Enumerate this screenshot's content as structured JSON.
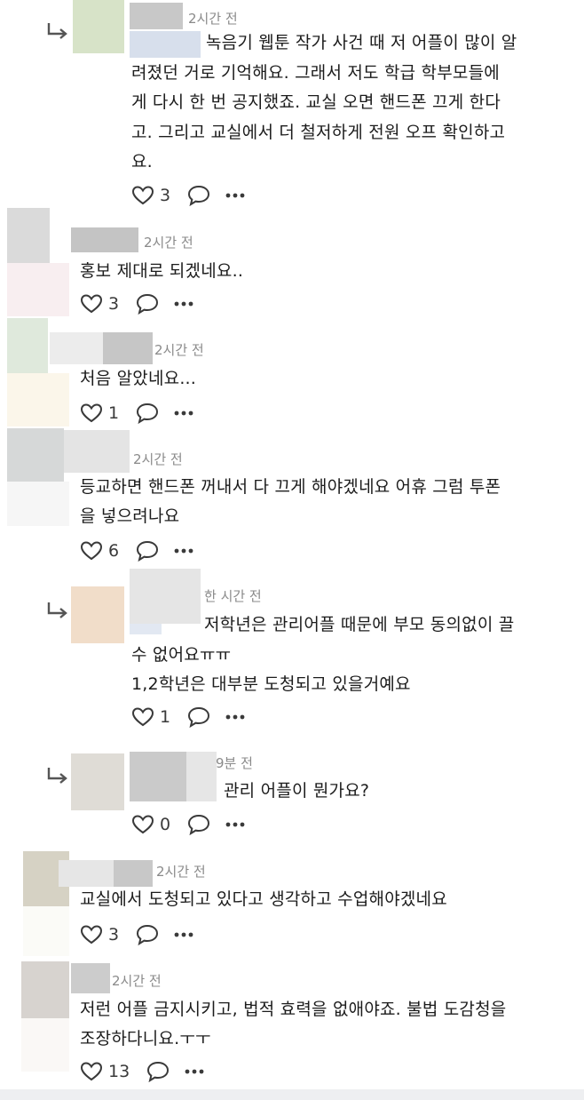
{
  "comments": [
    {
      "time": "2시간 전",
      "lines": [
        "녹음기 웹툰 작가 사건 때 저 어플이 많이 알",
        "려졌던 거로 기억해요. 그래서 저도 학급 학부모들에",
        "게 다시 한 번 공지했죠. 교실 오면 핸드폰 끄게 한다",
        "고. 그리고 교실에서 더 철저하게 전원 오프 확인하고",
        "요."
      ],
      "likes": "3"
    },
    {
      "time": "2시간 전",
      "lines": [
        "홍보 제대로 되겠네요.."
      ],
      "likes": "3"
    },
    {
      "time": "2시간 전",
      "lines": [
        "처음 알았네요..."
      ],
      "likes": "1"
    },
    {
      "time": "2시간 전",
      "lines": [
        "등교하면 핸드폰 꺼내서 다 끄게 해야겠네요 어휴 그럼 투폰",
        "을 넣으려나요"
      ],
      "likes": "6"
    },
    {
      "time": "한 시간 전",
      "lines": [
        "저학년은 관리어플 때문에 부모 동의없이 끌",
        "수 없어요ㅠㅠ",
        "1,2학년은 대부분 도청되고 있을거예요"
      ],
      "likes": "1"
    },
    {
      "time": "9분 전",
      "lines": [
        "관리 어플이 뭔가요?"
      ],
      "likes": "0"
    },
    {
      "time": "2시간 전",
      "lines": [
        "교실에서 도청되고 있다고 생각하고 수업해야겠네요"
      ],
      "likes": "3"
    },
    {
      "time": "2시간 전",
      "lines": [
        "저런 어플 금지시키고, 법적 효력을 없애야죠. 불법 도감청을",
        "조장하다니요.ㅜㅜ"
      ],
      "likes": "13"
    }
  ],
  "icons": {
    "like": "heart-icon",
    "comment": "comment-bubble-icon",
    "more": "more-dots-icon",
    "reply": "reply-arrow-icon"
  },
  "colors": {
    "text": "#1c1c1c",
    "meta": "#8a8a8a",
    "icon": "#3a3a3a"
  }
}
